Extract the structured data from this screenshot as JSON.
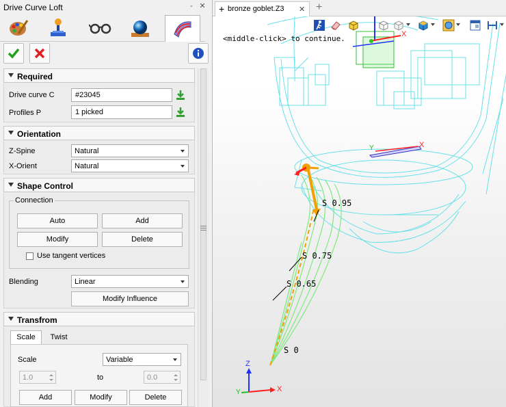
{
  "panel": {
    "title": "Drive Curve Loft",
    "title_buttons": [
      "‐",
      "✕"
    ],
    "tool_icons": [
      "paint-palette-icon",
      "joystick-icon",
      "glasses-icon",
      "sphere-icon",
      "loft-surface-icon"
    ],
    "ok_icon": "check-icon",
    "cancel_icon": "x-icon",
    "help_icon": "info-icon"
  },
  "required": {
    "header": "Required",
    "drive_curve_label": "Drive curve C",
    "drive_curve_value": "#23045",
    "profiles_label": "Profiles P",
    "profiles_value": "1 picked"
  },
  "orientation": {
    "header": "Orientation",
    "zspine_label": "Z-Spine",
    "zspine_value": "Natural",
    "xorient_label": "X-Orient",
    "xorient_value": "Natural"
  },
  "shape_control": {
    "header": "Shape Control",
    "connection_label": "Connection",
    "auto_label": "Auto",
    "add_label": "Add",
    "modify_label": "Modify",
    "delete_label": "Delete",
    "tangent_label": "Use tangent vertices",
    "blending_label": "Blending",
    "blending_value": "Linear",
    "modify_influence_label": "Modify Influence"
  },
  "transform": {
    "header": "Transfrom",
    "tab_scale": "Scale",
    "tab_twist": "Twist",
    "scale_label": "Scale",
    "scale_value": "Variable",
    "from_value": "1.0",
    "to_label": "to",
    "to_value": "0.0",
    "add_label": "Add",
    "modify_label": "Modify",
    "delete_label": "Delete"
  },
  "view": {
    "tab_title": "bronze goblet.Z3",
    "tab_plus": "+",
    "add_tab": "+",
    "prompt": "<middle-click> to continue.",
    "labels": [
      "S 0.95",
      "S 0.75",
      "S 0.65",
      "S 0"
    ],
    "axis_labels": {
      "x": "X",
      "y": "Y",
      "z": "Z"
    },
    "colors": {
      "wire": "#66e0e8",
      "loft": "#7fe87f",
      "axis_x": "#ff2020",
      "axis_y": "#20c020",
      "axis_z": "#2030ff",
      "handle": "#f0a000"
    }
  }
}
